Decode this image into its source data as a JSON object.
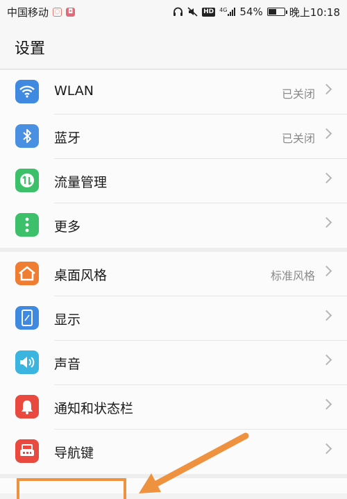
{
  "status_bar": {
    "carrier": "中国移动",
    "net_type": "4G",
    "battery": "54%",
    "battery_level": 0.54,
    "time": "晚上10:18",
    "icons": [
      "headset-icon",
      "mute-icon",
      "hd-icon",
      "signal-icon",
      "battery-icon"
    ]
  },
  "header": {
    "title": "设置"
  },
  "groups": [
    {
      "items": [
        {
          "label": "WLAN",
          "value": "已关闭",
          "icon": "wifi-icon",
          "color": "#3f8ae0"
        },
        {
          "label": "蓝牙",
          "value": "已关闭",
          "icon": "bluetooth-icon",
          "color": "#4a90e2"
        },
        {
          "label": "流量管理",
          "value": "",
          "icon": "data-usage-icon",
          "color": "#3cc06a"
        },
        {
          "label": "更多",
          "value": "",
          "icon": "more-icon",
          "color": "#3cc06a"
        }
      ]
    },
    {
      "items": [
        {
          "label": "桌面风格",
          "value": "标准风格",
          "icon": "home-style-icon",
          "color": "#ef7d32"
        },
        {
          "label": "显示",
          "value": "",
          "icon": "display-icon",
          "color": "#3f8ae0"
        },
        {
          "label": "声音",
          "value": "",
          "icon": "sound-icon",
          "color": "#3bb5e0"
        },
        {
          "label": "通知和状态栏",
          "value": "",
          "icon": "notification-icon",
          "color": "#e9493e"
        },
        {
          "label": "导航键",
          "value": "",
          "icon": "nav-key-icon",
          "color": "#e9493e"
        }
      ]
    }
  ],
  "annotation_color": "#ee9240"
}
